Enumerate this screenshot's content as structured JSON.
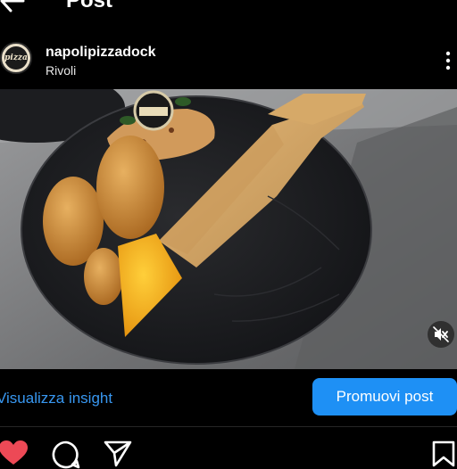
{
  "header": {
    "title": "Post"
  },
  "post": {
    "username": "napolipizzadock",
    "location": "Rivoli",
    "avatar_logo_text": "pizza"
  },
  "media": {
    "description_icon": "mute-icon"
  },
  "actions_bar": {
    "insight_link": "Visualizza insight",
    "promote_button": "Promuovi post"
  },
  "icons": [
    "back-arrow-icon",
    "more-options-icon",
    "mute-icon",
    "heart-icon",
    "comment-icon",
    "share-icon",
    "bookmark-icon"
  ],
  "colors": {
    "accent": "#1e90f5",
    "link": "#3897f0",
    "heart": "#ed4956",
    "background": "#000000"
  }
}
